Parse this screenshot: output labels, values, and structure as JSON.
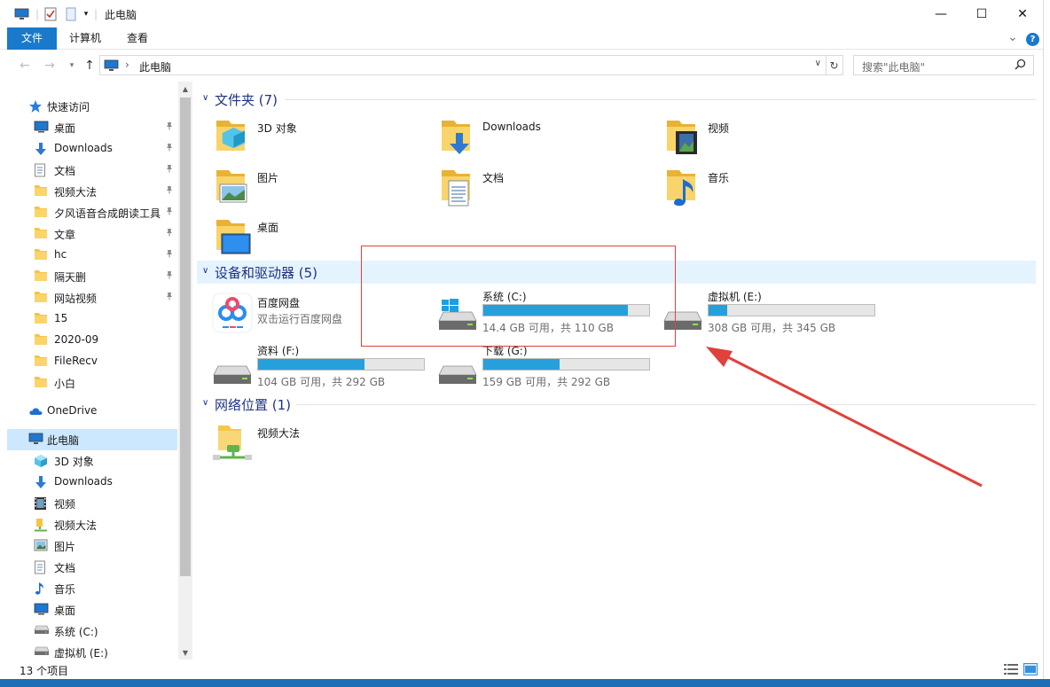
{
  "window": {
    "title": "此电脑",
    "min_glyph": "—",
    "max_glyph": "☐",
    "close_glyph": "✕"
  },
  "ribbon": {
    "tabs": [
      "文件",
      "计算机",
      "查看"
    ],
    "help_glyph": "?",
    "collapse_glyph": "⌄"
  },
  "address": {
    "crumb": "此电脑",
    "separator": "›",
    "search_placeholder": "搜索\"此电脑\""
  },
  "nav": {
    "quick_access": "快速访问",
    "quick_items": [
      {
        "label": "桌面",
        "icon": "desktop-icon"
      },
      {
        "label": "Downloads",
        "icon": "download-icon"
      },
      {
        "label": "文档",
        "icon": "document-icon"
      },
      {
        "label": "视频大法",
        "icon": "folder-icon"
      },
      {
        "label": "夕风语音合成朗读工具V",
        "icon": "folder-icon"
      },
      {
        "label": "文章",
        "icon": "folder-icon"
      },
      {
        "label": "hc",
        "icon": "folder-icon"
      },
      {
        "label": "隔天删",
        "icon": "folder-icon"
      },
      {
        "label": "网站视频",
        "icon": "folder-icon"
      },
      {
        "label": "15",
        "icon": "folder-icon"
      },
      {
        "label": "2020-09",
        "icon": "folder-icon"
      },
      {
        "label": "FileRecv",
        "icon": "folder-icon"
      },
      {
        "label": "小白",
        "icon": "folder-icon"
      }
    ],
    "onedrive": "OneDrive",
    "this_pc": "此电脑",
    "pc_items": [
      {
        "label": "3D 对象",
        "icon": "3d-objects-icon"
      },
      {
        "label": "Downloads",
        "icon": "download-icon"
      },
      {
        "label": "视频",
        "icon": "video-icon"
      },
      {
        "label": "视频大法",
        "icon": "network-folder-icon"
      },
      {
        "label": "图片",
        "icon": "picture-icon"
      },
      {
        "label": "文档",
        "icon": "document-icon"
      },
      {
        "label": "音乐",
        "icon": "music-icon"
      },
      {
        "label": "桌面",
        "icon": "desktop-icon"
      },
      {
        "label": "系统 (C:)",
        "icon": "drive-icon"
      },
      {
        "label": "虚拟机 (E:)",
        "icon": "drive-icon"
      }
    ]
  },
  "groups": {
    "folders": "文件夹 (7)",
    "devices": "设备和驱动器 (5)",
    "network": "网络位置 (1)"
  },
  "folders": [
    {
      "name": "3D 对象",
      "icon": "3d-objects-folder-icon"
    },
    {
      "name": "Downloads",
      "icon": "downloads-folder-icon"
    },
    {
      "name": "视频",
      "icon": "video-folder-icon"
    },
    {
      "name": "图片",
      "icon": "pictures-folder-icon"
    },
    {
      "name": "文档",
      "icon": "documents-folder-icon"
    },
    {
      "name": "音乐",
      "icon": "music-folder-icon"
    },
    {
      "name": "桌面",
      "icon": "desktop-folder-icon"
    }
  ],
  "baidu": {
    "name": "百度网盘",
    "sub": "双击运行百度网盘",
    "icon": "baidu-netdisk-icon"
  },
  "drives": [
    {
      "name": "系统 (C:)",
      "size": "14.4 GB 可用，共 110 GB",
      "used": 0.87
    },
    {
      "name": "虚拟机 (E:)",
      "size": "308 GB 可用，共 345 GB",
      "used": 0.11
    },
    {
      "name": "资料 (F:)",
      "size": "104 GB 可用，共 292 GB",
      "used": 0.64
    },
    {
      "name": "下载 (G:)",
      "size": "159 GB 可用，共 292 GB",
      "used": 0.46
    }
  ],
  "network_items": [
    {
      "name": "视频大法",
      "icon": "network-location-icon"
    }
  ],
  "status": {
    "count": "13 个项目"
  },
  "colors": {
    "accent": "#1979ca",
    "bar_fill": "#26a0da",
    "annotation": "#e0413a"
  }
}
